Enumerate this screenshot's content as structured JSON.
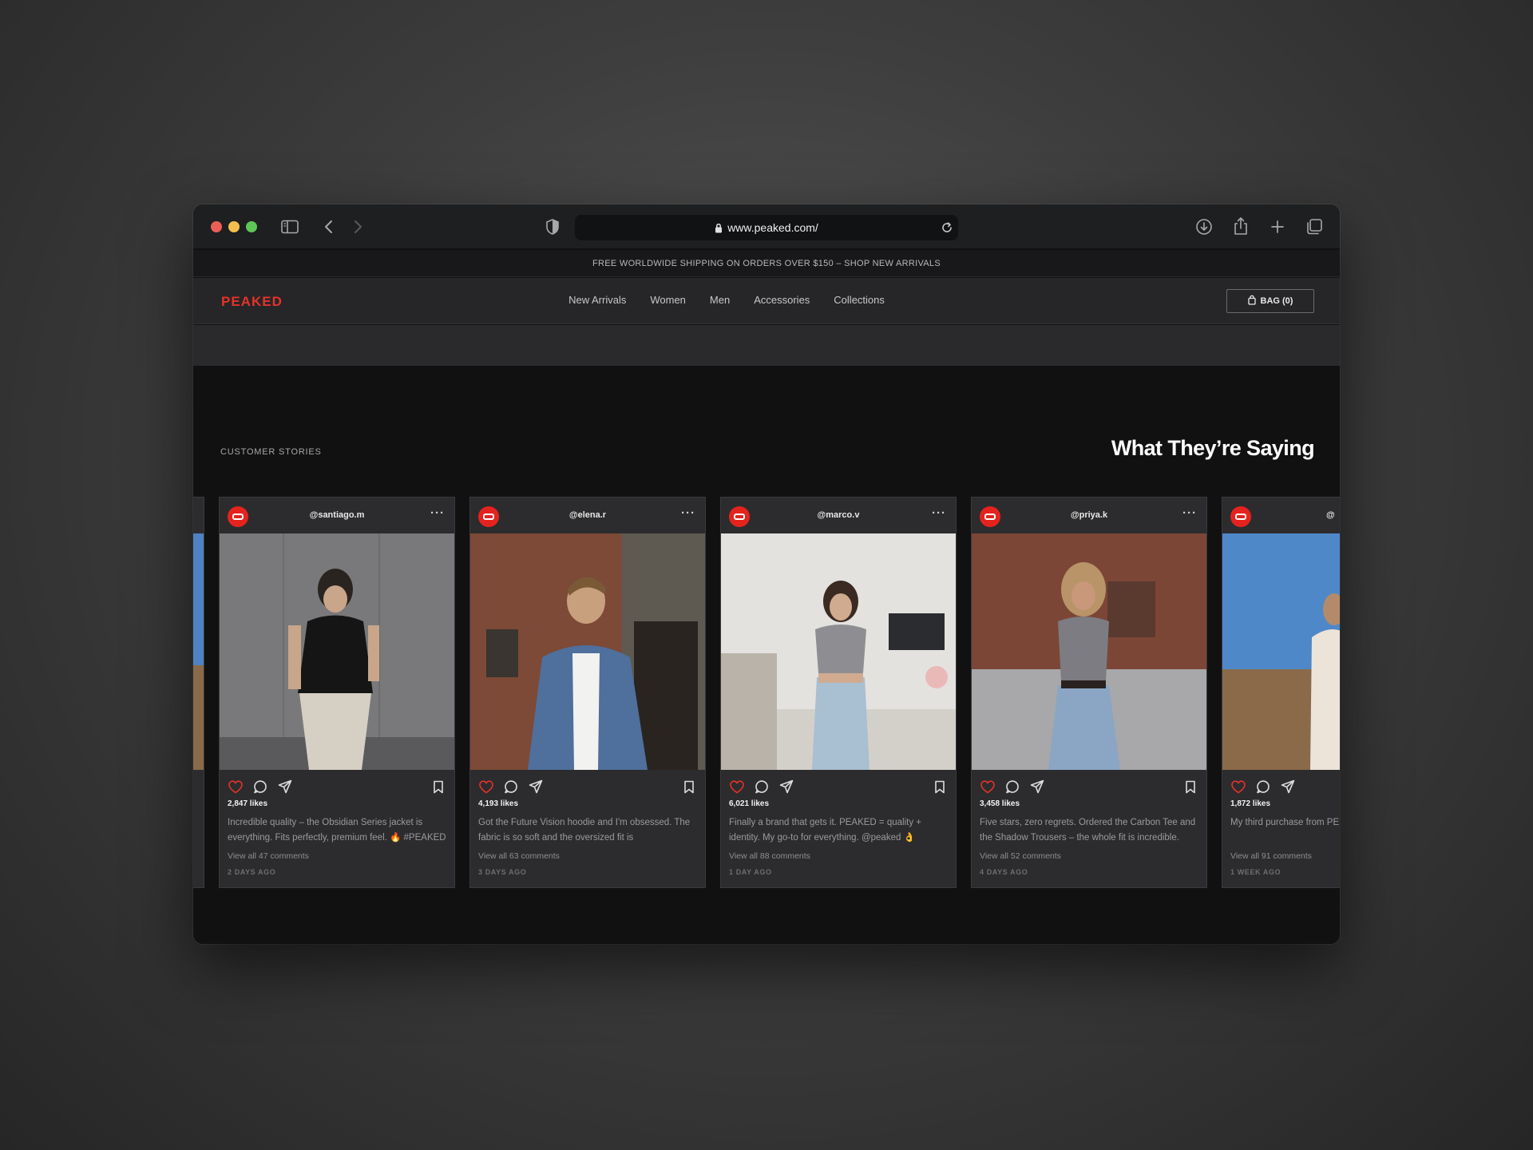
{
  "browser": {
    "url": "www.peaked.com/",
    "colors": {
      "close": "#ec5f56",
      "minimize": "#f4be4f",
      "zoom": "#5ec656"
    },
    "icons": [
      "sidebar-icon",
      "back-icon",
      "forward-icon",
      "shield-icon",
      "lock-icon",
      "reload-icon",
      "download-icon",
      "share-icon",
      "new-tab-icon",
      "tabs-overview-icon"
    ]
  },
  "announcement": "FREE WORLDWIDE SHIPPING ON ORDERS OVER $150 – SHOP NEW ARRIVALS",
  "nav": {
    "logo": "PEAKED",
    "links": [
      "New Arrivals",
      "Women",
      "Men",
      "Accessories",
      "Collections"
    ],
    "bag_label": "BAG (0)"
  },
  "section": {
    "eyebrow": "CUSTOMER STORIES",
    "heading": "What They’re Saying"
  },
  "posts": [
    {
      "handle": "@santiago.m",
      "likes": "2,847 likes",
      "caption": "Incredible quality – the Obsidian Series jacket is everything. Fits perfectly, premium feel. 🔥 #PEAKED",
      "comments": "View all 47 comments",
      "time": "2 DAYS AGO"
    },
    {
      "handle": "@elena.r",
      "likes": "4,193 likes",
      "caption": "Got the Future Vision hoodie and I'm obsessed. The fabric is so soft and the oversized fit is",
      "comments": "View all 63 comments",
      "time": "3 DAYS AGO"
    },
    {
      "handle": "@marco.v",
      "likes": "6,021 likes",
      "caption": "Finally a brand that gets it. PEAKED = quality + identity. My go-to for everything. @peaked 👌",
      "comments": "View all 88 comments",
      "time": "1 DAY AGO"
    },
    {
      "handle": "@priya.k",
      "likes": "3,458 likes",
      "caption": "Five stars, zero regrets. Ordered the Carbon Tee and the Shadow Trousers – the whole fit is incredible.",
      "comments": "View all 52 comments",
      "time": "4 DAYS AGO"
    },
    {
      "handle": "@",
      "likes": "1,872 likes",
      "caption": "My third purchase from PE... delivering.",
      "comments": "View all 91 comments",
      "time": "1 WEEK AGO"
    }
  ],
  "theme": {
    "accent": "#e5231e",
    "heart": "#e5322b"
  }
}
